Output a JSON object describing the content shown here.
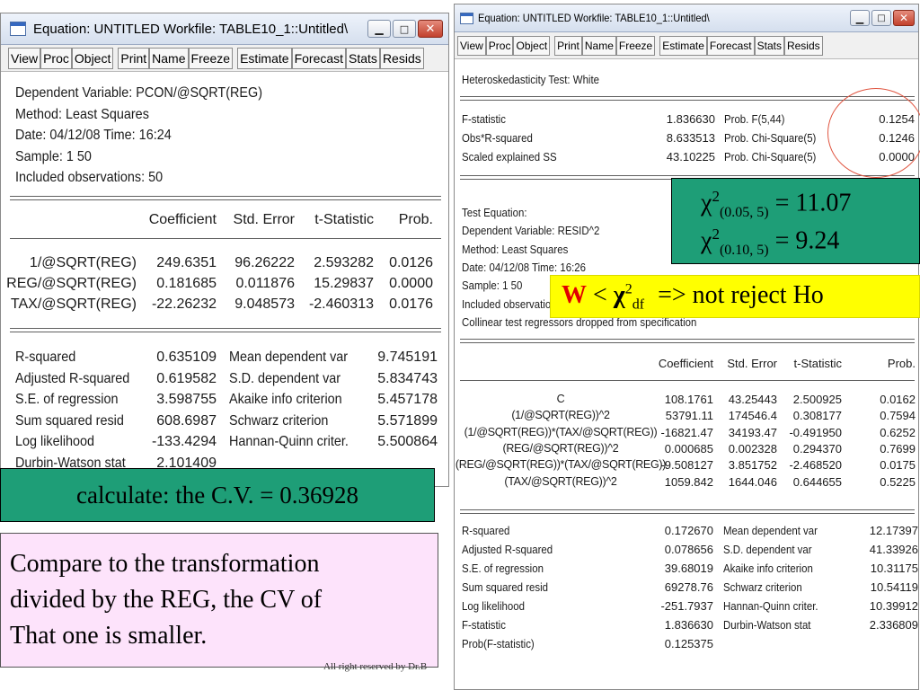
{
  "left_window": {
    "title": "Equation: UNTITLED   Workfile: TABLE10_1::Untitled\\",
    "toolbar": [
      "View",
      "Proc",
      "Object",
      "Print",
      "Name",
      "Freeze",
      "Estimate",
      "Forecast",
      "Stats",
      "Resids"
    ],
    "header": [
      "Dependent Variable: PCON/@SQRT(REG)",
      "Method: Least Squares",
      "Date: 04/12/08   Time: 16:24",
      "Sample: 1 50",
      "Included observations: 50"
    ],
    "coef_columns": [
      "Coefficient",
      "Std. Error",
      "t-Statistic",
      "Prob."
    ],
    "coef_rows": [
      [
        "1/@SQRT(REG)",
        "249.6351",
        "96.26222",
        "2.593282",
        "0.0126"
      ],
      [
        "REG/@SQRT(REG)",
        "0.181685",
        "0.011876",
        "15.29837",
        "0.0000"
      ],
      [
        "TAX/@SQRT(REG)",
        "-22.26232",
        "9.048573",
        "-2.460313",
        "0.0176"
      ]
    ],
    "stats_rows": [
      [
        "R-squared",
        "0.635109",
        "Mean dependent var",
        "9.745191"
      ],
      [
        "Adjusted R-squared",
        "0.619582",
        "S.D. dependent var",
        "5.834743"
      ],
      [
        "S.E. of regression",
        "3.598755",
        "Akaike info criterion",
        "5.457178"
      ],
      [
        "Sum squared resid",
        "608.6987",
        "Schwarz criterion",
        "5.571899"
      ],
      [
        "Log likelihood",
        "-133.4294",
        "Hannan-Quinn criter.",
        "5.500864"
      ],
      [
        "Durbin-Watson stat",
        "2.101409",
        "",
        ""
      ]
    ]
  },
  "right_window": {
    "title": "Equation: UNTITLED   Workfile: TABLE10_1::Untitled\\",
    "toolbar": [
      "View",
      "Proc",
      "Object",
      "Print",
      "Name",
      "Freeze",
      "Estimate",
      "Forecast",
      "Stats",
      "Resids"
    ],
    "test_title": "Heteroskedasticity Test: White",
    "test_rows": [
      [
        "F-statistic",
        "1.836630",
        "Prob. F(5,44)",
        "0.1254"
      ],
      [
        "Obs*R-squared",
        "8.633513",
        "Prob. Chi-Square(5)",
        "0.1246"
      ],
      [
        "Scaled explained SS",
        "43.10225",
        "Prob. Chi-Square(5)",
        "0.0000"
      ]
    ],
    "eq_header": [
      "Test Equation:",
      "Dependent Variable: RESID^2",
      "Method: Least Squares",
      "Date: 04/12/08   Time: 16:26",
      "Sample: 1 50",
      "Included observations: 50",
      "Collinear test regressors dropped from specification"
    ],
    "coef_columns": [
      "Coefficient",
      "Std. Error",
      "t-Statistic",
      "Prob."
    ],
    "coef_rows": [
      [
        "C",
        "108.1761",
        "43.25443",
        "2.500925",
        "0.0162"
      ],
      [
        "(1/@SQRT(REG))^2",
        "53791.11",
        "174546.4",
        "0.308177",
        "0.7594"
      ],
      [
        "(1/@SQRT(REG))*(TAX/@SQRT(REG))",
        "-16821.47",
        "34193.47",
        "-0.491950",
        "0.6252"
      ],
      [
        "(REG/@SQRT(REG))^2",
        "0.000685",
        "0.002328",
        "0.294370",
        "0.7699"
      ],
      [
        "(REG/@SQRT(REG))*(TAX/@SQRT(REG))",
        "-9.508127",
        "3.851752",
        "-2.468520",
        "0.0175"
      ],
      [
        "(TAX/@SQRT(REG))^2",
        "1059.842",
        "1644.046",
        "0.644655",
        "0.5225"
      ]
    ],
    "stats_rows": [
      [
        "R-squared",
        "0.172670",
        "Mean dependent var",
        "12.17397"
      ],
      [
        "Adjusted R-squared",
        "0.078656",
        "S.D. dependent var",
        "41.33926"
      ],
      [
        "S.E. of regression",
        "39.68019",
        "Akaike info criterion",
        "10.31175"
      ],
      [
        "Sum squared resid",
        "69278.76",
        "Schwarz criterion",
        "10.54119"
      ],
      [
        "Log likelihood",
        "-251.7937",
        "Hannan-Quinn criter.",
        "10.39912"
      ],
      [
        "F-statistic",
        "1.836630",
        "Durbin-Watson stat",
        "2.336809"
      ],
      [
        "Prob(F-statistic)",
        "0.125375",
        "",
        ""
      ]
    ]
  },
  "chi_box": {
    "chi": "χ",
    "sup": "2",
    "row1_sub": "(0.05, 5)",
    "row1_val": "= 11.07",
    "row2_sub": "(0.10, 5)",
    "row2_val": "= 9.24"
  },
  "decision": {
    "w": "W",
    "lt": "<",
    "chi": "χ",
    "sup": "2",
    "sub": "df",
    "rest": "=> not reject Ho"
  },
  "cv_box": "calculate: the C.V. = 0.36928",
  "compare_box": [
    "Compare to the transformation",
    "divided by the REG, the CV of",
    "That one is smaller."
  ],
  "footer": "All right reserved by Dr.B",
  "colors": {
    "green_box": "#1e9e77",
    "yellow_box": "#ffff00",
    "pink_box": "#fde3fb",
    "red_circle": "#e05540",
    "w_red": "#e00000"
  }
}
